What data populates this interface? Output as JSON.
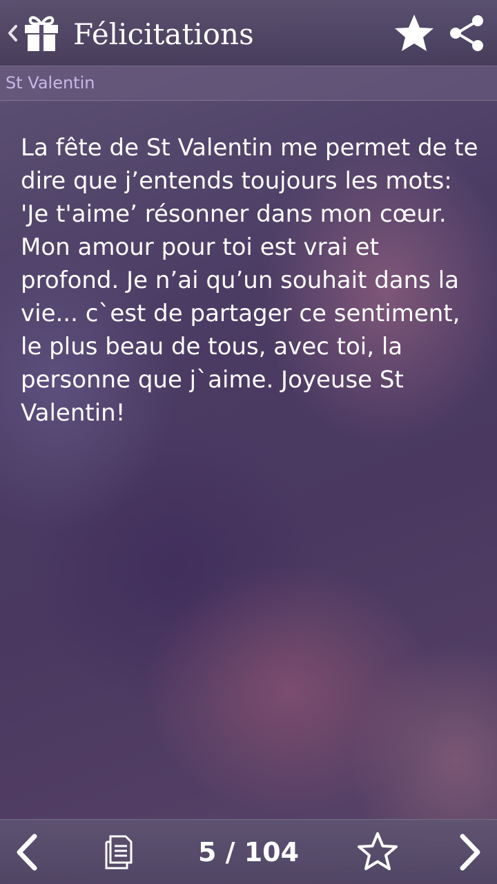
{
  "header": {
    "title": "Félicitations",
    "back_icon": "chevron-left-icon",
    "app_icon": "gift-icon",
    "favorite_icon": "star-filled-icon",
    "share_icon": "share-icon"
  },
  "category": {
    "label": "St Valentin"
  },
  "message": {
    "text": "La fête de St Valentin me permet de te dire que j’entends toujours les mots: 'Je t'aime’ résonner dans mon cœur. Mon amour pour toi est vrai et profond. Je n’ai qu’un souhait dans la vie... c`est de partager ce sentiment, le plus beau de tous, avec toi, la personne que j`aime. Joyeuse St Valentin!"
  },
  "footer": {
    "page_indicator": "5 / 104",
    "prev_icon": "chevron-left-icon",
    "list_icon": "document-list-icon",
    "favorite_icon": "star-outline-icon",
    "next_icon": "chevron-right-icon"
  },
  "colors": {
    "category_text": "#c9b7e6",
    "text": "#ffffff"
  }
}
